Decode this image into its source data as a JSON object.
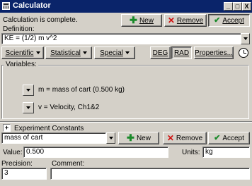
{
  "window": {
    "title": "Calculator",
    "controls": {
      "minimize": "_",
      "maximize": "□",
      "close": "X"
    }
  },
  "status_text": "Calculation is complete.",
  "toolbar": {
    "new_label": "New",
    "remove_label": "Remove",
    "accept_label": "Accept"
  },
  "definition": {
    "label": "Definition:",
    "value": "KE = (1/2) m v^2"
  },
  "functions": {
    "scientific": "Scientific",
    "statistical": "Statistical",
    "special": "Special",
    "deg": "DEG",
    "rad": "RAD",
    "properties": "Properties...",
    "active_mode": "RAD"
  },
  "variables": {
    "label": "Variables:",
    "items": [
      {
        "text": "m = mass of cart (0.500 kg)"
      },
      {
        "text": "v = Velocity, Ch1&2"
      }
    ]
  },
  "experiment_constants": {
    "label": "Experiment Constants",
    "checkbox_mark": "+",
    "selected": "mass of cart",
    "new_label": "New",
    "remove_label": "Remove",
    "accept_label": "Accept",
    "value_label": "Value:",
    "value": "0.500",
    "units_label": "Units:",
    "units": "kg",
    "precision_label": "Precision:",
    "precision": "3",
    "comment_label": "Comment:",
    "comment": ""
  },
  "colors": {
    "titlebar": "#0a246a",
    "face": "#d4d0c8",
    "plus_green": "#1a8a2a",
    "remove_red": "#d01010"
  },
  "icons": [
    "window-menu-icon",
    "plus-icon",
    "x-icon",
    "check-icon",
    "chevron-down-icon",
    "clock-icon"
  ]
}
